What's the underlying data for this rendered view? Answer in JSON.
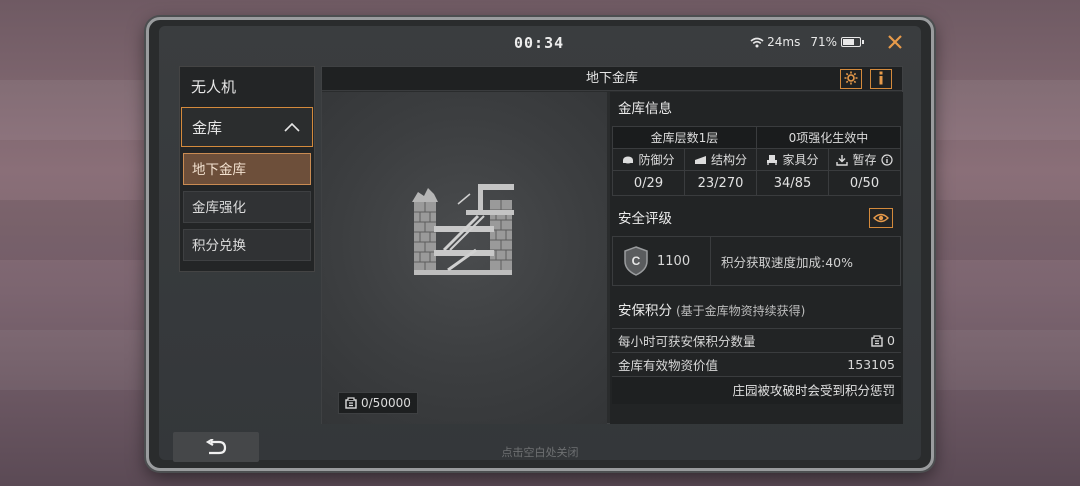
{
  "status": {
    "time": "00:34",
    "ping": "24ms",
    "battery": "71%",
    "battery_level": 0.71
  },
  "menu": {
    "title": "无人机",
    "category": "金库",
    "items": [
      {
        "label": "地下金库",
        "active": true
      },
      {
        "label": "金库强化",
        "active": false
      },
      {
        "label": "积分兑换",
        "active": false
      }
    ]
  },
  "panel": {
    "title": "地下金库"
  },
  "vault": {
    "capacity": "0/50000"
  },
  "vault_info": {
    "title": "金库信息",
    "floors": "金库层数1层",
    "enhancements": "0项强化生效中",
    "stats": [
      {
        "label": "防御分",
        "value": "0/29",
        "icon": "shield-icon"
      },
      {
        "label": "结构分",
        "value": "23/270",
        "icon": "stairs-icon"
      },
      {
        "label": "家具分",
        "value": "34/85",
        "icon": "chair-icon"
      },
      {
        "label": "暂存",
        "value": "0/50",
        "icon": "download-icon"
      }
    ]
  },
  "security": {
    "title": "安全评级",
    "badge": "C",
    "score": "1100",
    "bonus": "积分获取速度加成:40%"
  },
  "points": {
    "title": "安保积分",
    "subtitle": "(基于金库物资持续获得)",
    "per_hour_label": "每小时可获安保积分数量",
    "per_hour_value": "0",
    "value_label": "金库有效物资价值",
    "value": "153105",
    "warning": "庄园被攻破时会受到积分惩罚"
  },
  "hint": "点击空白处关闭",
  "colors": {
    "accent": "#d48a3c",
    "active_item": "#6d4f3a"
  }
}
